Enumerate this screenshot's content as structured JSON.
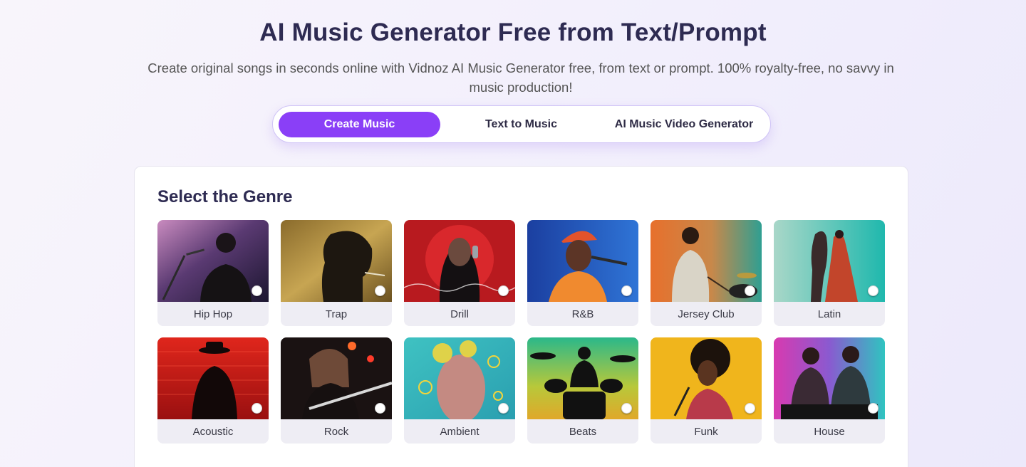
{
  "hero": {
    "title": "AI Music Generator Free from Text/Prompt",
    "subtitle": "Create original songs in seconds online with Vidnoz AI Music Generator free, from text or prompt. 100% royalty-free, no savvy in music production!"
  },
  "tabs": [
    {
      "label": "Create Music",
      "active": true
    },
    {
      "label": "Text to Music",
      "active": false
    },
    {
      "label": "AI Music Video Generator",
      "active": false
    }
  ],
  "genre_panel": {
    "title": "Select the Genre",
    "genres": [
      {
        "label": "Hip Hop",
        "icon": "hip-hop-thumbnail",
        "selected": false
      },
      {
        "label": "Trap",
        "icon": "trap-thumbnail",
        "selected": false
      },
      {
        "label": "Drill",
        "icon": "drill-thumbnail",
        "selected": false
      },
      {
        "label": "R&B",
        "icon": "rnb-thumbnail",
        "selected": false
      },
      {
        "label": "Jersey Club",
        "icon": "jersey-club-thumbnail",
        "selected": false
      },
      {
        "label": "Latin",
        "icon": "latin-thumbnail",
        "selected": false
      },
      {
        "label": "Acoustic",
        "icon": "acoustic-thumbnail",
        "selected": false
      },
      {
        "label": "Rock",
        "icon": "rock-thumbnail",
        "selected": false
      },
      {
        "label": "Ambient",
        "icon": "ambient-thumbnail",
        "selected": false
      },
      {
        "label": "Beats",
        "icon": "beats-thumbnail",
        "selected": false
      },
      {
        "label": "Funk",
        "icon": "funk-thumbnail",
        "selected": false
      },
      {
        "label": "House",
        "icon": "house-thumbnail",
        "selected": false
      }
    ]
  },
  "colors": {
    "accent": "#8a3ff7",
    "title": "#2e2b52",
    "tab_border": "#cfc3f6"
  }
}
